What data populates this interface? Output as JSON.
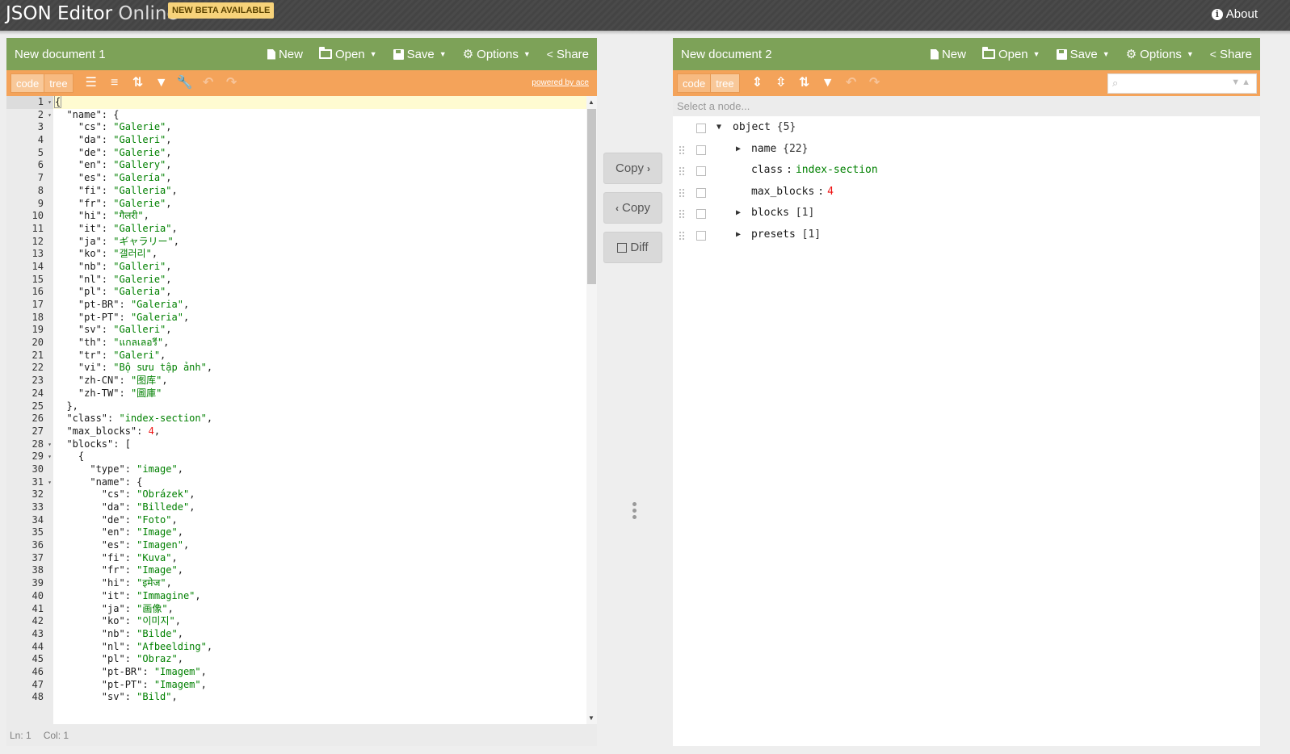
{
  "app": {
    "title_main": "JSON Editor",
    "title_thin": "Online",
    "beta_badge": "NEW BETA AVAILABLE",
    "about_label": "About"
  },
  "left": {
    "doc_title": "New document 1",
    "menu": {
      "new": "New",
      "open": "Open",
      "save": "Save",
      "options": "Options",
      "share": "Share"
    },
    "modes": {
      "code": "code",
      "tree": "tree"
    },
    "powered_by": "powered by ace",
    "status": {
      "ln": "Ln: 1",
      "col": "Col: 1"
    },
    "code_lines": [
      {
        "n": "1",
        "fold": true,
        "parts": [
          [
            "p",
            "{"
          ]
        ]
      },
      {
        "n": "2",
        "fold": true,
        "parts": [
          [
            "k",
            "  \"name\""
          ],
          [
            "p",
            ": {"
          ]
        ]
      },
      {
        "n": "3",
        "parts": [
          [
            "k",
            "    \"cs\""
          ],
          [
            "p",
            ": "
          ],
          [
            "s",
            "\"Galerie\""
          ],
          [
            "p",
            ","
          ]
        ]
      },
      {
        "n": "4",
        "parts": [
          [
            "k",
            "    \"da\""
          ],
          [
            "p",
            ": "
          ],
          [
            "s",
            "\"Galleri\""
          ],
          [
            "p",
            ","
          ]
        ]
      },
      {
        "n": "5",
        "parts": [
          [
            "k",
            "    \"de\""
          ],
          [
            "p",
            ": "
          ],
          [
            "s",
            "\"Galerie\""
          ],
          [
            "p",
            ","
          ]
        ]
      },
      {
        "n": "6",
        "parts": [
          [
            "k",
            "    \"en\""
          ],
          [
            "p",
            ": "
          ],
          [
            "s",
            "\"Gallery\""
          ],
          [
            "p",
            ","
          ]
        ]
      },
      {
        "n": "7",
        "parts": [
          [
            "k",
            "    \"es\""
          ],
          [
            "p",
            ": "
          ],
          [
            "s",
            "\"Galería\""
          ],
          [
            "p",
            ","
          ]
        ]
      },
      {
        "n": "8",
        "parts": [
          [
            "k",
            "    \"fi\""
          ],
          [
            "p",
            ": "
          ],
          [
            "s",
            "\"Galleria\""
          ],
          [
            "p",
            ","
          ]
        ]
      },
      {
        "n": "9",
        "parts": [
          [
            "k",
            "    \"fr\""
          ],
          [
            "p",
            ": "
          ],
          [
            "s",
            "\"Galerie\""
          ],
          [
            "p",
            ","
          ]
        ]
      },
      {
        "n": "10",
        "parts": [
          [
            "k",
            "    \"hi\""
          ],
          [
            "p",
            ": "
          ],
          [
            "s",
            "\"गैलरी\""
          ],
          [
            "p",
            ","
          ]
        ]
      },
      {
        "n": "11",
        "parts": [
          [
            "k",
            "    \"it\""
          ],
          [
            "p",
            ": "
          ],
          [
            "s",
            "\"Galleria\""
          ],
          [
            "p",
            ","
          ]
        ]
      },
      {
        "n": "12",
        "parts": [
          [
            "k",
            "    \"ja\""
          ],
          [
            "p",
            ": "
          ],
          [
            "s",
            "\"ギャラリー\""
          ],
          [
            "p",
            ","
          ]
        ]
      },
      {
        "n": "13",
        "parts": [
          [
            "k",
            "    \"ko\""
          ],
          [
            "p",
            ": "
          ],
          [
            "s",
            "\"갤러리\""
          ],
          [
            "p",
            ","
          ]
        ]
      },
      {
        "n": "14",
        "parts": [
          [
            "k",
            "    \"nb\""
          ],
          [
            "p",
            ": "
          ],
          [
            "s",
            "\"Galleri\""
          ],
          [
            "p",
            ","
          ]
        ]
      },
      {
        "n": "15",
        "parts": [
          [
            "k",
            "    \"nl\""
          ],
          [
            "p",
            ": "
          ],
          [
            "s",
            "\"Galerie\""
          ],
          [
            "p",
            ","
          ]
        ]
      },
      {
        "n": "16",
        "parts": [
          [
            "k",
            "    \"pl\""
          ],
          [
            "p",
            ": "
          ],
          [
            "s",
            "\"Galeria\""
          ],
          [
            "p",
            ","
          ]
        ]
      },
      {
        "n": "17",
        "parts": [
          [
            "k",
            "    \"pt-BR\""
          ],
          [
            "p",
            ": "
          ],
          [
            "s",
            "\"Galeria\""
          ],
          [
            "p",
            ","
          ]
        ]
      },
      {
        "n": "18",
        "parts": [
          [
            "k",
            "    \"pt-PT\""
          ],
          [
            "p",
            ": "
          ],
          [
            "s",
            "\"Galeria\""
          ],
          [
            "p",
            ","
          ]
        ]
      },
      {
        "n": "19",
        "parts": [
          [
            "k",
            "    \"sv\""
          ],
          [
            "p",
            ": "
          ],
          [
            "s",
            "\"Galleri\""
          ],
          [
            "p",
            ","
          ]
        ]
      },
      {
        "n": "20",
        "parts": [
          [
            "k",
            "    \"th\""
          ],
          [
            "p",
            ": "
          ],
          [
            "s",
            "\"แกลเลอรี\""
          ],
          [
            "p",
            ","
          ]
        ]
      },
      {
        "n": "21",
        "parts": [
          [
            "k",
            "    \"tr\""
          ],
          [
            "p",
            ": "
          ],
          [
            "s",
            "\"Galeri\""
          ],
          [
            "p",
            ","
          ]
        ]
      },
      {
        "n": "22",
        "parts": [
          [
            "k",
            "    \"vi\""
          ],
          [
            "p",
            ": "
          ],
          [
            "s",
            "\"Bộ sưu tập ảnh\""
          ],
          [
            "p",
            ","
          ]
        ]
      },
      {
        "n": "23",
        "parts": [
          [
            "k",
            "    \"zh-CN\""
          ],
          [
            "p",
            ": "
          ],
          [
            "s",
            "\"图库\""
          ],
          [
            "p",
            ","
          ]
        ]
      },
      {
        "n": "24",
        "parts": [
          [
            "k",
            "    \"zh-TW\""
          ],
          [
            "p",
            ": "
          ],
          [
            "s",
            "\"圖庫\""
          ]
        ]
      },
      {
        "n": "25",
        "parts": [
          [
            "p",
            "  },"
          ]
        ]
      },
      {
        "n": "26",
        "parts": [
          [
            "k",
            "  \"class\""
          ],
          [
            "p",
            ": "
          ],
          [
            "s",
            "\"index-section\""
          ],
          [
            "p",
            ","
          ]
        ]
      },
      {
        "n": "27",
        "parts": [
          [
            "k",
            "  \"max_blocks\""
          ],
          [
            "p",
            ": "
          ],
          [
            "n",
            "4"
          ],
          [
            "p",
            ","
          ]
        ]
      },
      {
        "n": "28",
        "fold": true,
        "parts": [
          [
            "k",
            "  \"blocks\""
          ],
          [
            "p",
            ": ["
          ]
        ]
      },
      {
        "n": "29",
        "fold": true,
        "parts": [
          [
            "p",
            "    {"
          ]
        ]
      },
      {
        "n": "30",
        "parts": [
          [
            "k",
            "      \"type\""
          ],
          [
            "p",
            ": "
          ],
          [
            "s",
            "\"image\""
          ],
          [
            "p",
            ","
          ]
        ]
      },
      {
        "n": "31",
        "fold": true,
        "parts": [
          [
            "k",
            "      \"name\""
          ],
          [
            "p",
            ": {"
          ]
        ]
      },
      {
        "n": "32",
        "parts": [
          [
            "k",
            "        \"cs\""
          ],
          [
            "p",
            ": "
          ],
          [
            "s",
            "\"Obrázek\""
          ],
          [
            "p",
            ","
          ]
        ]
      },
      {
        "n": "33",
        "parts": [
          [
            "k",
            "        \"da\""
          ],
          [
            "p",
            ": "
          ],
          [
            "s",
            "\"Billede\""
          ],
          [
            "p",
            ","
          ]
        ]
      },
      {
        "n": "34",
        "parts": [
          [
            "k",
            "        \"de\""
          ],
          [
            "p",
            ": "
          ],
          [
            "s",
            "\"Foto\""
          ],
          [
            "p",
            ","
          ]
        ]
      },
      {
        "n": "35",
        "parts": [
          [
            "k",
            "        \"en\""
          ],
          [
            "p",
            ": "
          ],
          [
            "s",
            "\"Image\""
          ],
          [
            "p",
            ","
          ]
        ]
      },
      {
        "n": "36",
        "parts": [
          [
            "k",
            "        \"es\""
          ],
          [
            "p",
            ": "
          ],
          [
            "s",
            "\"Imagen\""
          ],
          [
            "p",
            ","
          ]
        ]
      },
      {
        "n": "37",
        "parts": [
          [
            "k",
            "        \"fi\""
          ],
          [
            "p",
            ": "
          ],
          [
            "s",
            "\"Kuva\""
          ],
          [
            "p",
            ","
          ]
        ]
      },
      {
        "n": "38",
        "parts": [
          [
            "k",
            "        \"fr\""
          ],
          [
            "p",
            ": "
          ],
          [
            "s",
            "\"Image\""
          ],
          [
            "p",
            ","
          ]
        ]
      },
      {
        "n": "39",
        "parts": [
          [
            "k",
            "        \"hi\""
          ],
          [
            "p",
            ": "
          ],
          [
            "s",
            "\"इमेज\""
          ],
          [
            "p",
            ","
          ]
        ]
      },
      {
        "n": "40",
        "parts": [
          [
            "k",
            "        \"it\""
          ],
          [
            "p",
            ": "
          ],
          [
            "s",
            "\"Immagine\""
          ],
          [
            "p",
            ","
          ]
        ]
      },
      {
        "n": "41",
        "parts": [
          [
            "k",
            "        \"ja\""
          ],
          [
            "p",
            ": "
          ],
          [
            "s",
            "\"画像\""
          ],
          [
            "p",
            ","
          ]
        ]
      },
      {
        "n": "42",
        "parts": [
          [
            "k",
            "        \"ko\""
          ],
          [
            "p",
            ": "
          ],
          [
            "s",
            "\"이미지\""
          ],
          [
            "p",
            ","
          ]
        ]
      },
      {
        "n": "43",
        "parts": [
          [
            "k",
            "        \"nb\""
          ],
          [
            "p",
            ": "
          ],
          [
            "s",
            "\"Bilde\""
          ],
          [
            "p",
            ","
          ]
        ]
      },
      {
        "n": "44",
        "parts": [
          [
            "k",
            "        \"nl\""
          ],
          [
            "p",
            ": "
          ],
          [
            "s",
            "\"Afbeelding\""
          ],
          [
            "p",
            ","
          ]
        ]
      },
      {
        "n": "45",
        "parts": [
          [
            "k",
            "        \"pl\""
          ],
          [
            "p",
            ": "
          ],
          [
            "s",
            "\"Obraz\""
          ],
          [
            "p",
            ","
          ]
        ]
      },
      {
        "n": "46",
        "parts": [
          [
            "k",
            "        \"pt-BR\""
          ],
          [
            "p",
            ": "
          ],
          [
            "s",
            "\"Imagem\""
          ],
          [
            "p",
            ","
          ]
        ]
      },
      {
        "n": "47",
        "parts": [
          [
            "k",
            "        \"pt-PT\""
          ],
          [
            "p",
            ": "
          ],
          [
            "s",
            "\"Imagem\""
          ],
          [
            "p",
            ","
          ]
        ]
      },
      {
        "n": "48",
        "parts": [
          [
            "k",
            "        \"sv\""
          ],
          [
            "p",
            ": "
          ],
          [
            "s",
            "\"Bild\""
          ],
          [
            "p",
            ","
          ]
        ]
      }
    ]
  },
  "middle": {
    "copy_right": "Copy",
    "copy_left": "Copy",
    "diff": "Diff"
  },
  "right": {
    "doc_title": "New document 2",
    "menu": {
      "new": "New",
      "open": "Open",
      "save": "Save",
      "options": "Options",
      "share": "Share"
    },
    "modes": {
      "code": "code",
      "tree": "tree"
    },
    "navbar": "Select a node...",
    "tree": {
      "root": {
        "key": "object",
        "meta": "{5}"
      },
      "children": [
        {
          "key": "name",
          "meta": "{22}",
          "expandable": true
        },
        {
          "key": "class",
          "value": "index-section",
          "type": "string"
        },
        {
          "key": "max_blocks",
          "value": "4",
          "type": "number"
        },
        {
          "key": "blocks",
          "meta": "[1]",
          "expandable": true
        },
        {
          "key": "presets",
          "meta": "[1]",
          "expandable": true
        }
      ]
    }
  },
  "colors": {
    "menu_green": "#7da258",
    "menu_orange": "#f4a35a",
    "string": "#008000",
    "number": "#ee1111"
  }
}
